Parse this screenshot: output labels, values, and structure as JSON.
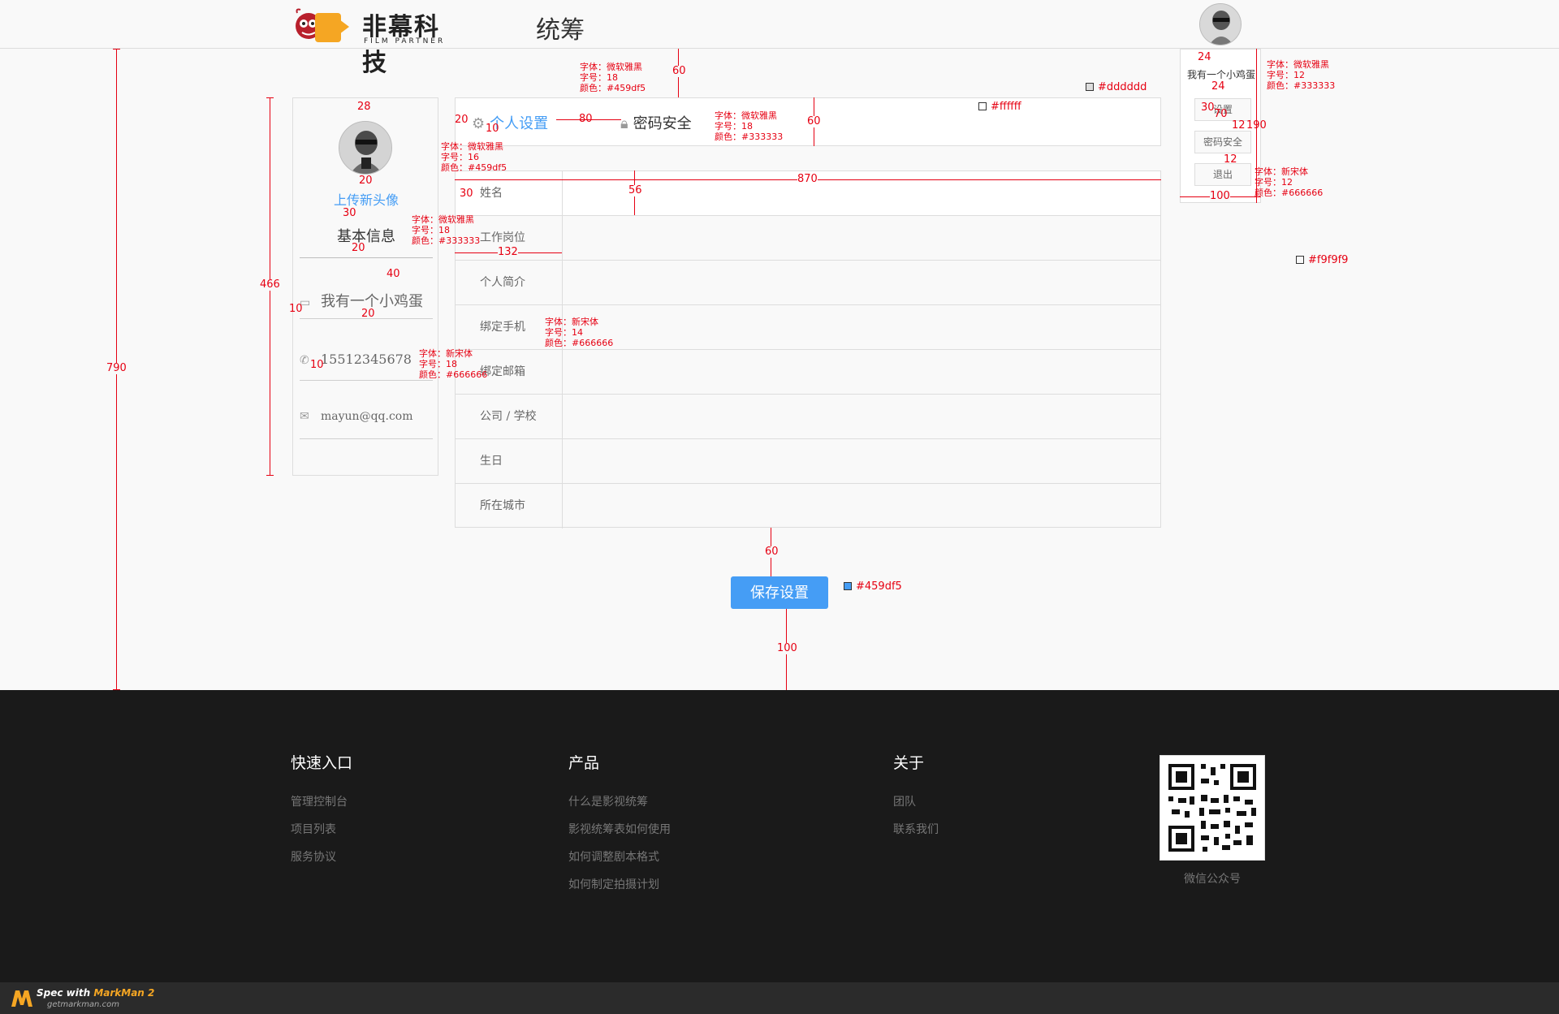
{
  "header": {
    "brand_name": "非幕科技",
    "brand_sub": "FILM PARTNER",
    "page_title": "统筹"
  },
  "user_menu": {
    "username": "我有一个小鸡蛋",
    "items": [
      {
        "label": "设置"
      },
      {
        "label": "密码安全"
      },
      {
        "label": "退出"
      }
    ]
  },
  "sidebar": {
    "upload_avatar": "上传新头像",
    "basic_info": "基本信息",
    "nickname": "我有一个小鸡蛋",
    "phone": "15512345678",
    "email": "mayun@qq.com"
  },
  "tabs": [
    {
      "label": "个人设置",
      "icon": "gear-icon",
      "active": true
    },
    {
      "label": "密码安全",
      "icon": "lock-icon",
      "active": false
    }
  ],
  "form": {
    "rows": [
      {
        "label": "姓名",
        "value": ""
      },
      {
        "label": "工作岗位",
        "value": ""
      },
      {
        "label": "个人简介",
        "value": ""
      },
      {
        "label": "绑定手机",
        "value": ""
      },
      {
        "label": "绑定邮箱",
        "value": ""
      },
      {
        "label": "公司 / 学校",
        "value": ""
      },
      {
        "label": "生日",
        "value": ""
      },
      {
        "label": "所在城市",
        "value": ""
      }
    ],
    "save_label": "保存设置"
  },
  "footer": {
    "columns": [
      {
        "title": "快速入口",
        "links": [
          "管理控制台",
          "项目列表",
          "服务协议"
        ]
      },
      {
        "title": "产品",
        "links": [
          "什么是影视统筹",
          "影视统筹表如何使用",
          "如何调整剧本格式",
          "如何制定拍摄计划"
        ]
      },
      {
        "title": "关于",
        "links": [
          "团队",
          "联系我们"
        ]
      }
    ],
    "qr_label": "微信公众号"
  },
  "markman": {
    "spec_with": "Spec with ",
    "product": "MarkMan 2",
    "url": "getmarkman.com"
  },
  "annotations": {
    "font_yahei": "字体：微软雅黑",
    "font_songti": "字体：新宋体",
    "size_18": "字号：18",
    "size_16": "字号：16",
    "size_14": "字号：14",
    "size_12": "字号：12",
    "color_459df5": "颜色：#459df5",
    "color_333333": "颜色：#333333",
    "color_666666": "颜色：#666666",
    "swatch_dddddd": "#dddddd",
    "swatch_ffffff": "#ffffff",
    "swatch_f9f9f9": "#f9f9f9",
    "swatch_459df5": "#459df5",
    "dims": {
      "d790": "790",
      "d466": "466",
      "d28": "28",
      "d20": "20",
      "d30": "30",
      "d40": "40",
      "d10": "10",
      "d60": "60",
      "d80": "80",
      "d56": "56",
      "d870": "870",
      "d132": "132",
      "d100": "100",
      "d24": "24",
      "d70": "70",
      "d12": "12",
      "d190": "190"
    }
  },
  "colors": {
    "primary": "#459df5",
    "text_dark": "#333333",
    "text_gray": "#666666",
    "border": "#dddddd",
    "page_bg": "#f9f9f9",
    "white": "#ffffff",
    "footer_bg": "#1a1a1a",
    "annotation": "#e60012"
  }
}
